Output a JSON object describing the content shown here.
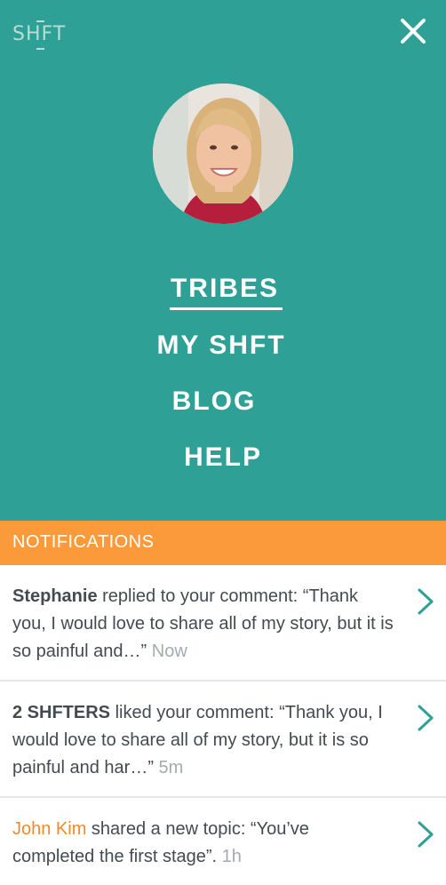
{
  "logo": {
    "text": "SHFT"
  },
  "menu": {
    "items": [
      {
        "label": "TRIBES",
        "active": true
      },
      {
        "label": "MY SHFT",
        "active": false
      },
      {
        "label": "BLOG",
        "active": false
      },
      {
        "label": "HELP",
        "active": false
      }
    ]
  },
  "notifications": {
    "header": "NOTIFICATIONS",
    "items": [
      {
        "actor": "Stephanie",
        "text": " replied to your comment: “Thank you, I would love to share all of my story, but it is so painful and…” ",
        "time": "Now"
      },
      {
        "actor": "2 SHFTERS",
        "text": " liked your comment: “Thank you, I would love to share all of my story, but it is so painful and har…” ",
        "time": "5m"
      },
      {
        "actor": "John Kim",
        "text": " shared a new topic: “You’ve completed the first stage”. ",
        "time": "1h"
      }
    ]
  },
  "colors": {
    "teal": "#2fa095",
    "orange": "#fb9a3b",
    "accent_orange": "#f08a2c",
    "text": "#444b4f"
  },
  "icons": {
    "close": "close-icon",
    "chevron": "chevron-right-icon"
  }
}
